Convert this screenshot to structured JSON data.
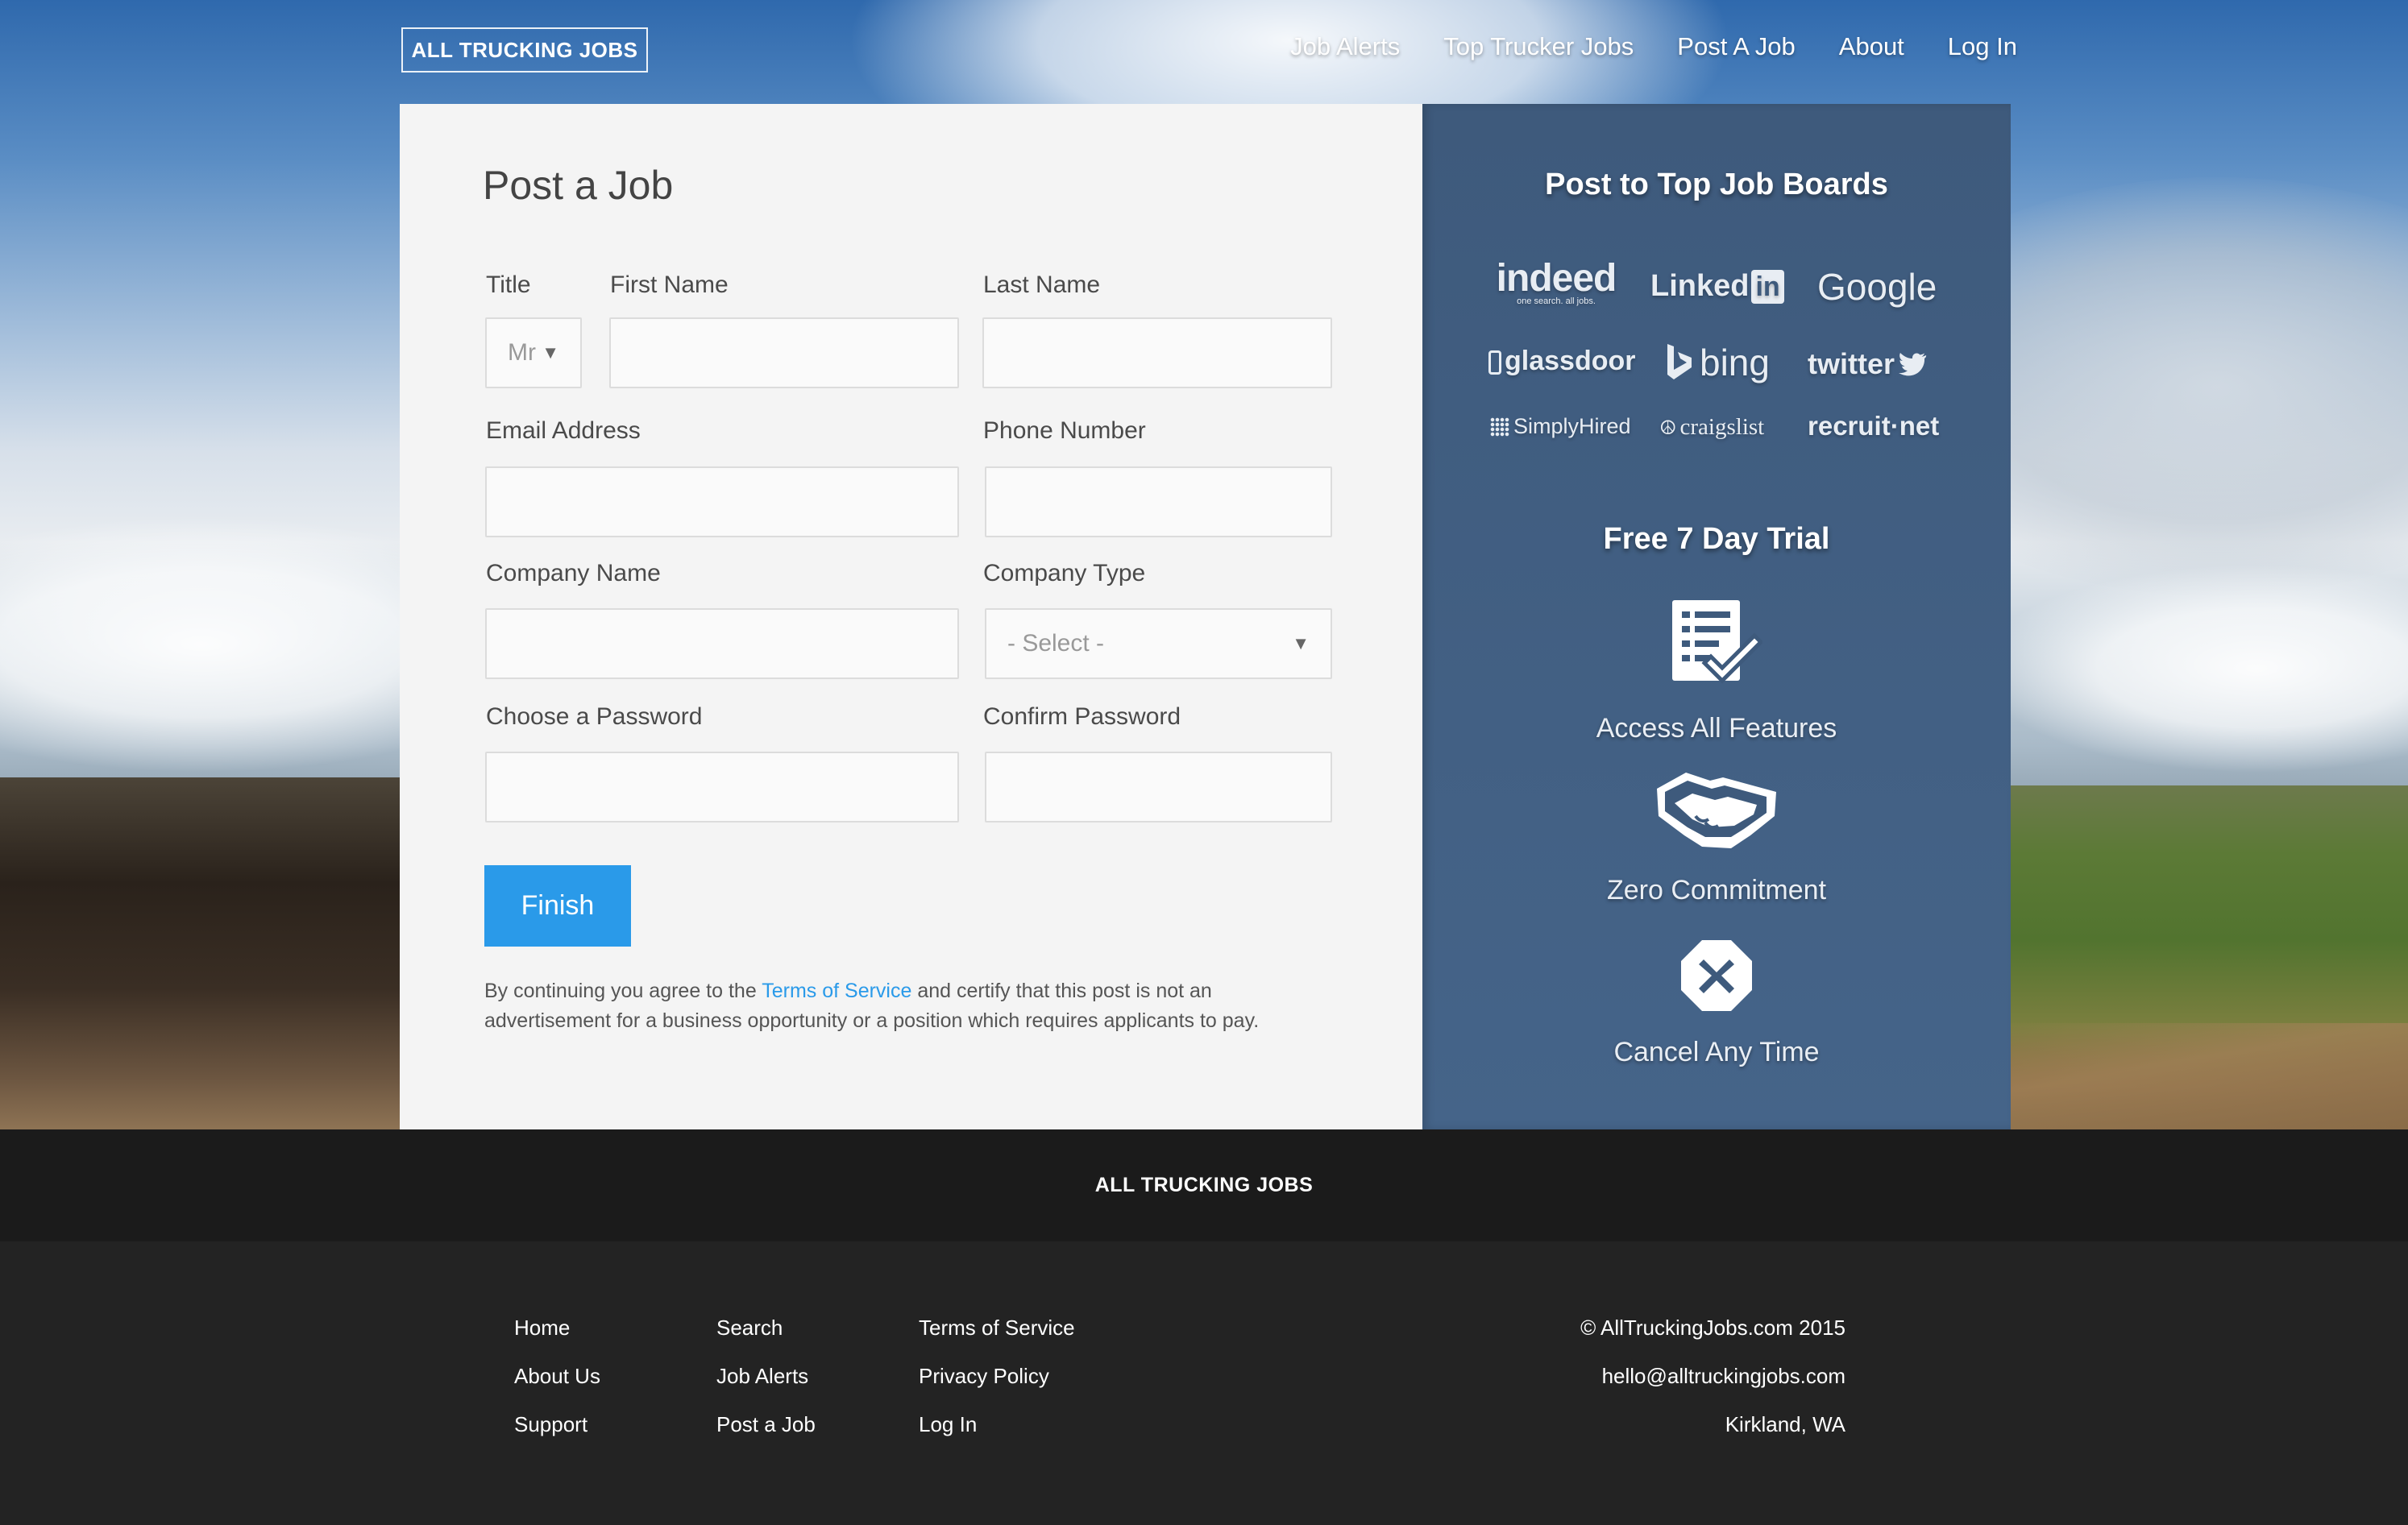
{
  "brand": "ALL TRUCKING JOBS",
  "nav": {
    "items": [
      "Job Alerts",
      "Top Trucker Jobs",
      "Post A Job",
      "About",
      "Log In"
    ]
  },
  "form": {
    "title": "Post a Job",
    "labels": {
      "title": "Title",
      "first_name": "First Name",
      "last_name": "Last Name",
      "email": "Email Address",
      "phone": "Phone Number",
      "company_name": "Company Name",
      "company_type": "Company Type",
      "password": "Choose a Password",
      "confirm_password": "Confirm Password"
    },
    "values": {
      "title": "Mr",
      "company_type": "- Select -"
    },
    "finish_label": "Finish",
    "terms": {
      "before": "By continuing you agree to the ",
      "link": "Terms of Service",
      "after": " and certify that this post is not an advertisement for a business opportunity or a position which requires applicants to pay."
    }
  },
  "sidebar": {
    "boards_title": "Post to Top Job Boards",
    "boards": [
      "indeed",
      "Linked",
      "in",
      "Google",
      "glassdoor",
      "bing",
      "twitter",
      "SimplyHired",
      "craigslist",
      "recruit·net"
    ],
    "indeed_tagline": "one search. all jobs.",
    "trial_title": "Free 7 Day Trial",
    "features": [
      {
        "label": "Access All Features",
        "icon": "checklist-icon"
      },
      {
        "label": "Zero Commitment",
        "icon": "handshake-icon"
      },
      {
        "label": "Cancel Any Time",
        "icon": "cancel-icon"
      }
    ]
  },
  "footer": {
    "brand": "ALL TRUCKING JOBS",
    "col1": [
      "Home",
      "About Us",
      "Support"
    ],
    "col2": [
      "Search",
      "Job Alerts",
      "Post a Job"
    ],
    "col3": [
      "Terms of Service",
      "Privacy Policy",
      "Log In"
    ],
    "info": [
      "© AllTruckingJobs.com 2015",
      "hello@alltruckingjobs.com",
      "Kirkland, WA"
    ]
  },
  "colors": {
    "accent": "#2a9ae9",
    "sidebar": "#3e5a7c",
    "footer_dark": "#1b1b1b"
  }
}
